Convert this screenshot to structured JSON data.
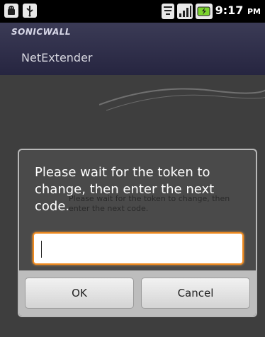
{
  "status_bar": {
    "time": "9:17",
    "ampm": "PM",
    "icons": [
      "android-debug-icon",
      "usb-icon",
      "wifi-icon",
      "signal-icon",
      "battery-charging-icon"
    ]
  },
  "app": {
    "brand": "SONICWALL",
    "title": "NetExtender"
  },
  "dialog": {
    "message": "Please wait for the token to change, then enter the next code.",
    "background_message": "Please wait for the token to change, then enter the next code.",
    "input_value": "",
    "ok_label": "OK",
    "cancel_label": "Cancel"
  },
  "colors": {
    "input_focus": "#f08a1e",
    "battery": "#7bd32e"
  }
}
